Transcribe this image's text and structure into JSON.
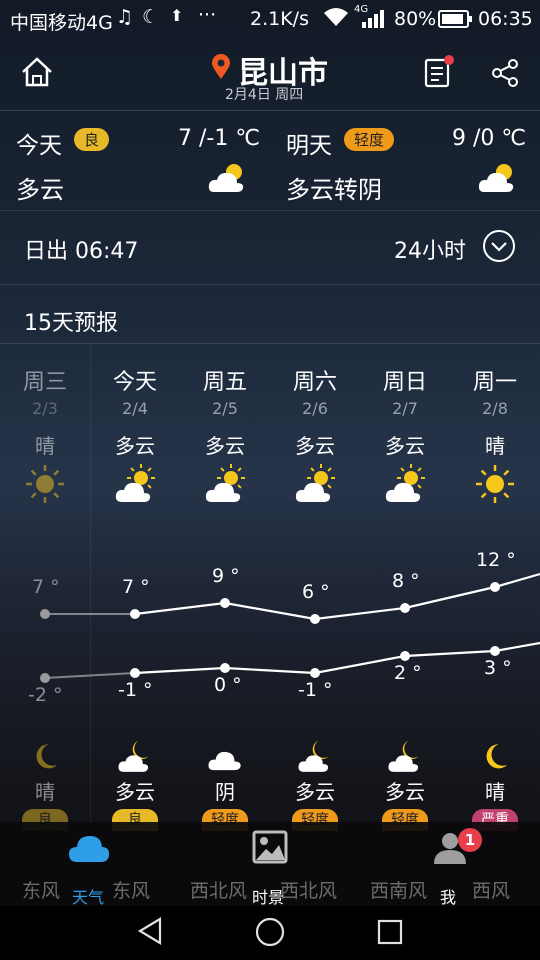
{
  "status_bar": {
    "carrier": "中国移动4G",
    "speed": "2.1K/s",
    "network": "4G",
    "battery": "80%",
    "time": "06:35"
  },
  "header": {
    "city": "昆山市",
    "date": "2月4日 周四"
  },
  "today": {
    "label": "今天",
    "aqi": "良",
    "temp": "7 /-1 ℃",
    "condition": "多云"
  },
  "tomorrow": {
    "label": "明天",
    "aqi": "轻度",
    "temp": "9 /0 ℃",
    "condition": "多云转阴"
  },
  "sunrise": "日出 06:47",
  "hours_toggle": "24小时",
  "forecast_title": "15天预报",
  "forecast": [
    {
      "day": "周三",
      "date": "2/3",
      "cond": "晴",
      "icon": "sun-icon",
      "high": "7 °",
      "low": "-2 °",
      "night_icon": "moon-icon",
      "night_cond": "晴",
      "aqi": "良",
      "aqi_color": "#e8b926",
      "wind": "东风",
      "past": true,
      "high_value": 7,
      "low_value": -2
    },
    {
      "day": "今天",
      "date": "2/4",
      "cond": "多云",
      "icon": "partly-cloudy-icon",
      "high": "7 °",
      "low": "-1 °",
      "night_icon": "cloudy-moon-icon",
      "night_cond": "多云",
      "aqi": "良",
      "aqi_color": "#e8b926",
      "wind": "东风",
      "past": false,
      "high_value": 7,
      "low_value": -1
    },
    {
      "day": "周五",
      "date": "2/5",
      "cond": "多云",
      "icon": "partly-cloudy-icon",
      "high": "9 °",
      "low": "0 °",
      "night_icon": "cloud-icon",
      "night_cond": "阴",
      "aqi": "轻度",
      "aqi_color": "#f09a1c",
      "wind": "西北风",
      "past": false,
      "high_value": 9,
      "low_value": 0
    },
    {
      "day": "周六",
      "date": "2/6",
      "cond": "多云",
      "icon": "partly-cloudy-icon",
      "high": "6 °",
      "low": "-1 °",
      "night_icon": "cloudy-moon-icon",
      "night_cond": "多云",
      "aqi": "轻度",
      "aqi_color": "#f09a1c",
      "wind": "西北风",
      "past": false,
      "high_value": 6,
      "low_value": -1
    },
    {
      "day": "周日",
      "date": "2/7",
      "cond": "多云",
      "icon": "partly-cloudy-icon",
      "high": "8 °",
      "low": "2 °",
      "night_icon": "cloudy-moon-icon",
      "night_cond": "多云",
      "aqi": "轻度",
      "aqi_color": "#f09a1c",
      "wind": "西南风",
      "past": false,
      "high_value": 8,
      "low_value": 2
    },
    {
      "day": "周一",
      "date": "2/8",
      "cond": "晴",
      "icon": "sun-icon",
      "high": "12 °",
      "low": "3 °",
      "night_icon": "moon-icon",
      "night_cond": "晴",
      "aqi": "严重",
      "aqi_color": "#c0406e",
      "wind": "西风",
      "past": false,
      "high_value": 12,
      "low_value": 3
    }
  ],
  "tabs": [
    {
      "label": "天气",
      "icon": "cloud-icon",
      "active": true
    },
    {
      "label": "时景",
      "icon": "image-icon",
      "active": false
    },
    {
      "label": "我",
      "icon": "user-icon",
      "active": false,
      "badge": "1"
    }
  ],
  "colors": {
    "accent": "#2f9ee8",
    "aqi_good": "#e8b926",
    "aqi_light": "#f09a1c",
    "aqi_severe": "#c0406e",
    "location_pin": "#f05a22"
  }
}
